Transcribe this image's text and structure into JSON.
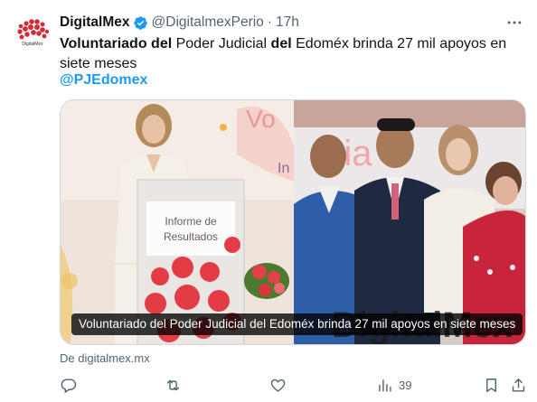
{
  "author": {
    "name": "DigitalMex",
    "handle": "@DigitalmexPerio",
    "separator": "·",
    "time": "17h",
    "avatar_text": "DigitalMex"
  },
  "tweet": {
    "text_parts": {
      "p1": "Voluntariado del",
      "p2": " Poder Judicial ",
      "p3": "del",
      "p4": " Edoméx brinda 27 mil apoyos en siete meses"
    },
    "mention": "@PJEdomex"
  },
  "media": {
    "caption": "Voluntariado del Poder Judicial del Edoméx brinda 27 mil apoyos en siete meses",
    "podium_text": "Informe de Resultados",
    "watermark_text": "DigitalMex"
  },
  "source": "De digitalmex.mx",
  "actions": {
    "reply_count": "",
    "retweet_count": "",
    "like_count": "",
    "views_count": "39"
  },
  "colors": {
    "accent": "#1d9bf0",
    "secondary_text": "#536471",
    "primary_text": "#0f1419"
  }
}
